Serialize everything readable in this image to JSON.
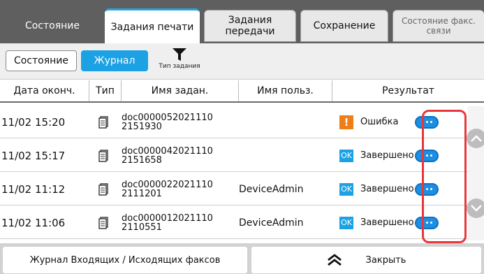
{
  "tabs": {
    "status": "Состояние",
    "print_jobs": "Задания печати",
    "transfer_jobs_line1": "Задания",
    "transfer_jobs_line2": "передачи",
    "storage": "Сохранение",
    "fax_status_line1": "Состояние факс.",
    "fax_status_line2": "связи"
  },
  "subbar": {
    "status_btn": "Состояние",
    "log_btn": "Журнал",
    "filter_label": "Тип задания"
  },
  "table": {
    "headers": {
      "end_date": "Дата оконч.",
      "type": "Тип",
      "job_name": "Имя задан.",
      "user_name": "Имя польз.",
      "result": "Результат"
    },
    "rows": [
      {
        "date": "11/02 15:20",
        "name_line1": "doc0000052021110",
        "name_line2": "2151930",
        "user": "",
        "status": "warning",
        "result": "Ошибка"
      },
      {
        "date": "11/02 15:17",
        "name_line1": "doc0000042021110",
        "name_line2": "2151658",
        "user": "",
        "status": "ok",
        "result": "Завершено"
      },
      {
        "date": "11/02 11:12",
        "name_line1": "doc0000022021110",
        "name_line2": "2111201",
        "user": "DeviceAdmin",
        "status": "ok",
        "result": "Завершено"
      },
      {
        "date": "11/02 11:06",
        "name_line1": "doc0000012021110",
        "name_line2": "2110551",
        "user": "DeviceAdmin",
        "status": "ok",
        "result": "Завершено"
      }
    ],
    "status_labels": {
      "warning": "!",
      "ok": "OK"
    }
  },
  "bottom": {
    "fax_log": "Журнал Входящих / Исходящих факсов",
    "close": "Закрыть"
  },
  "colors": {
    "accent": "#1ca1e4",
    "tabbar": "#5f5f5f",
    "warning": "#f07e18",
    "highlight": "#e8363d"
  }
}
